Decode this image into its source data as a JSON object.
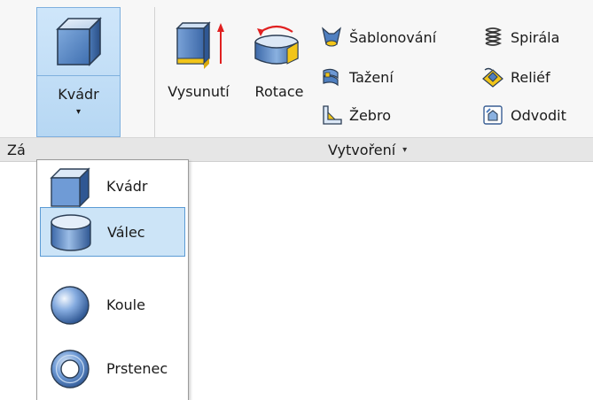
{
  "ribbon": {
    "kvadr_button": {
      "label": "Kvádr",
      "dropdown_glyph": "▾",
      "icon": "box-icon"
    },
    "big_buttons": [
      {
        "label": "Vysunutí",
        "icon": "extrude-icon"
      },
      {
        "label": "Rotace",
        "icon": "revolve-icon"
      }
    ],
    "small_buttons_col1": [
      {
        "label": "Šablonování",
        "icon": "loft-icon"
      },
      {
        "label": "Tažení",
        "icon": "sweep-icon"
      },
      {
        "label": "Žebro",
        "icon": "rib-icon"
      }
    ],
    "small_buttons_col2": [
      {
        "label": "Spirála",
        "icon": "coil-icon"
      },
      {
        "label": "Reliéf",
        "icon": "emboss-icon"
      },
      {
        "label": "Odvodit",
        "icon": "derive-icon"
      }
    ],
    "groups": {
      "left_label": "Zá",
      "create_label": "Vytvoření",
      "create_dropdown_glyph": "▾"
    }
  },
  "dropdown_menu": {
    "items": [
      {
        "label": "Kvádr",
        "icon": "box-icon",
        "selected": false
      },
      {
        "label": "Válec",
        "icon": "cylinder-icon",
        "selected": true
      },
      {
        "label": "Koule",
        "icon": "sphere-icon",
        "selected": false
      },
      {
        "label": "Prstenec",
        "icon": "torus-icon",
        "selected": false
      }
    ]
  }
}
